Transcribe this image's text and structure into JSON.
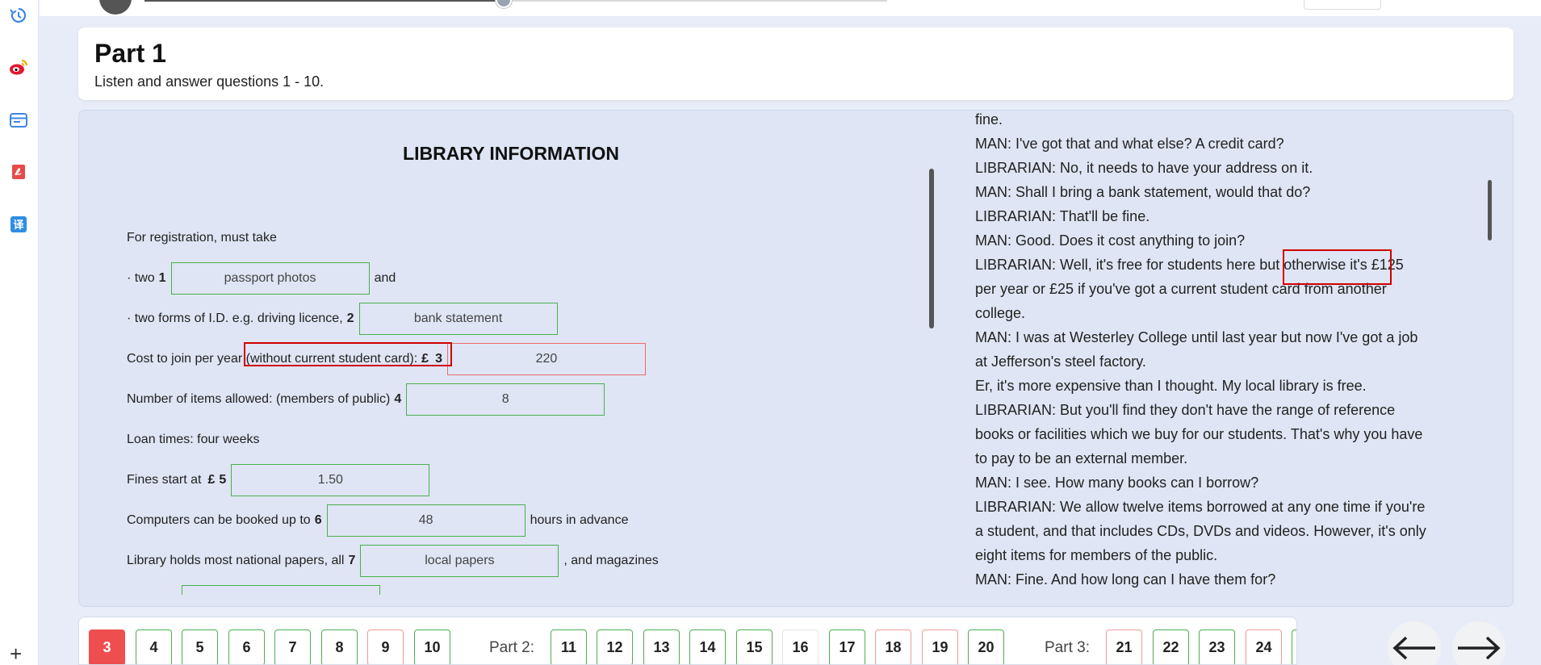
{
  "header": {
    "title": "Part 1",
    "subtitle": "Listen and answer questions 1 - 10."
  },
  "form": {
    "title": "LIBRARY INFORMATION",
    "intro": "For registration, must take",
    "q1_pre": "· two",
    "q1_num": "1",
    "q1_answer": "passport photos",
    "q1_post": "and",
    "q2_pre": "· two forms of I.D. e.g. driving licence,",
    "q2_num": "2",
    "q2_answer": "bank statement",
    "q3_pre": "Cost to join per year (without current student card):",
    "q3_currency": "£",
    "q3_num": "3",
    "q3_answer": "220",
    "q4_pre": "Number of items allowed: (members of public)",
    "q4_num": "4",
    "q4_answer": "8",
    "loan": "Loan times: four weeks",
    "q5_pre": "Fines start at",
    "q5_currency": "£",
    "q5_num": "5",
    "q5_answer": "1.50",
    "q6_pre": "Computers can be booked up to",
    "q6_num": "6",
    "q6_answer": "48",
    "q6_post": "hours in advance",
    "q7_pre": "Library holds most national papers, all",
    "q7_num": "7",
    "q7_answer": "local papers",
    "q7_post": ", and magazines"
  },
  "transcript": {
    "lines": [
      "fine.",
      "MAN: I've got that and what else? A credit card?",
      "LIBRARIAN: No, it needs to have your address on it.",
      "MAN: Shall I bring a bank statement, would that do?",
      "LIBRARIAN: That'll be fine.",
      "MAN: Good. Does it cost anything to join?",
      "LIBRARIAN: Well, it's free for students here but otherwise it's £125",
      "per year or £25 if you've got a current student card from another",
      "college.",
      "MAN: I was at Westerley College until last year but now I've got a job",
      "at Jefferson's steel factory.",
      "Er, it's more expensive than I thought. My local library is free.",
      "LIBRARIAN: But you'll find they don't have the range of reference",
      "books or facilities which we buy for our students. That's why you have",
      "to pay to be an external member.",
      "MAN: I see. How many books can I borrow?",
      "LIBRARIAN: We allow twelve items borrowed at any one time if you're",
      "a student, and that includes CDs, DVDs and videos. However, it's only",
      "eight items for members of the public.",
      "MAN: Fine. And how long can I have them for?"
    ]
  },
  "nav": {
    "part1_questions": [
      {
        "num": "3",
        "state": "active"
      },
      {
        "num": "4",
        "state": "correct"
      },
      {
        "num": "5",
        "state": "correct"
      },
      {
        "num": "6",
        "state": "correct"
      },
      {
        "num": "7",
        "state": "correct"
      },
      {
        "num": "8",
        "state": "correct"
      },
      {
        "num": "9",
        "state": "wrong"
      },
      {
        "num": "10",
        "state": "correct"
      }
    ],
    "part2_label": "Part 2:",
    "part2_questions": [
      {
        "num": "11",
        "state": "correct"
      },
      {
        "num": "12",
        "state": "correct"
      },
      {
        "num": "13",
        "state": "correct"
      },
      {
        "num": "14",
        "state": "correct"
      },
      {
        "num": "15",
        "state": "correct"
      },
      {
        "num": "16",
        "state": "plain"
      },
      {
        "num": "17",
        "state": "correct"
      },
      {
        "num": "18",
        "state": "wrong"
      },
      {
        "num": "19",
        "state": "wrong"
      },
      {
        "num": "20",
        "state": "correct"
      }
    ],
    "part3_label": "Part 3:",
    "part3_questions": [
      {
        "num": "21",
        "state": "wrong"
      },
      {
        "num": "22",
        "state": "correct"
      },
      {
        "num": "23",
        "state": "correct"
      },
      {
        "num": "24",
        "state": "wrong"
      }
    ]
  },
  "colors": {
    "correct": "#4caf50",
    "wrong": "#ef6b6b",
    "active": "#ee4e4e",
    "highlight": "#d00000"
  }
}
